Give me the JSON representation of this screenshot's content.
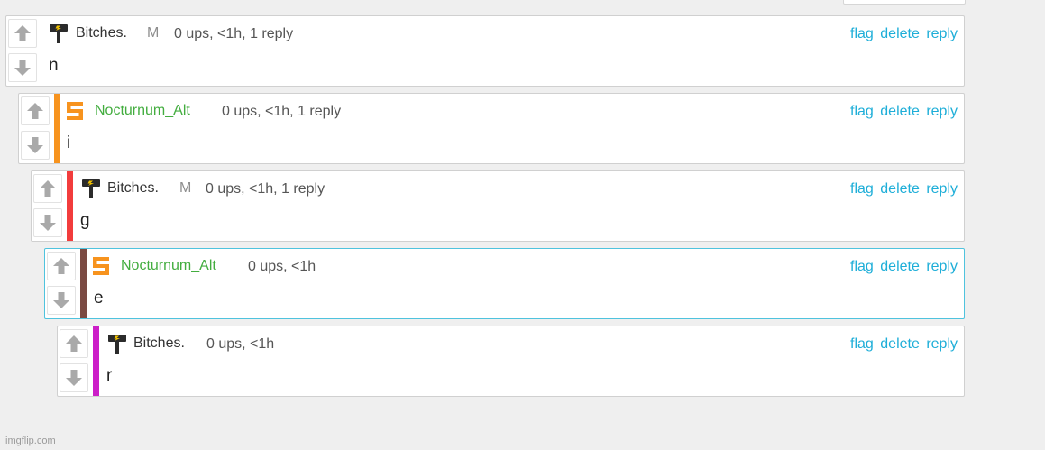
{
  "actions": {
    "flag": "flag",
    "delete": "delete",
    "reply": "reply"
  },
  "colors": {
    "link": "#1eaed8",
    "username_green": "#43ad3f",
    "stripe_orange": "#f7931e",
    "stripe_red": "#f23c3c",
    "stripe_brown": "#7a4a42",
    "stripe_magenta": "#cc1ec8",
    "highlight_border": "#4fc3de"
  },
  "comments": [
    {
      "username": "Bitches.",
      "badge": "M",
      "meta": "0 ups, <1h, 1 reply",
      "text": "n",
      "avatar_icon": "hammer-icon"
    },
    {
      "username": "Nocturnum_Alt",
      "meta": "0 ups, <1h, 1 reply",
      "text": "i",
      "avatar_icon": "s-logo-icon"
    },
    {
      "username": "Bitches.",
      "badge": "M",
      "meta": "0 ups, <1h, 1 reply",
      "text": "g",
      "avatar_icon": "hammer-icon"
    },
    {
      "username": "Nocturnum_Alt",
      "meta": "0 ups, <1h",
      "text": "e",
      "avatar_icon": "s-logo-icon"
    },
    {
      "username": "Bitches.",
      "meta": "0 ups, <1h",
      "text": "r",
      "avatar_icon": "hammer-icon"
    }
  ],
  "watermark": "imgflip.com"
}
